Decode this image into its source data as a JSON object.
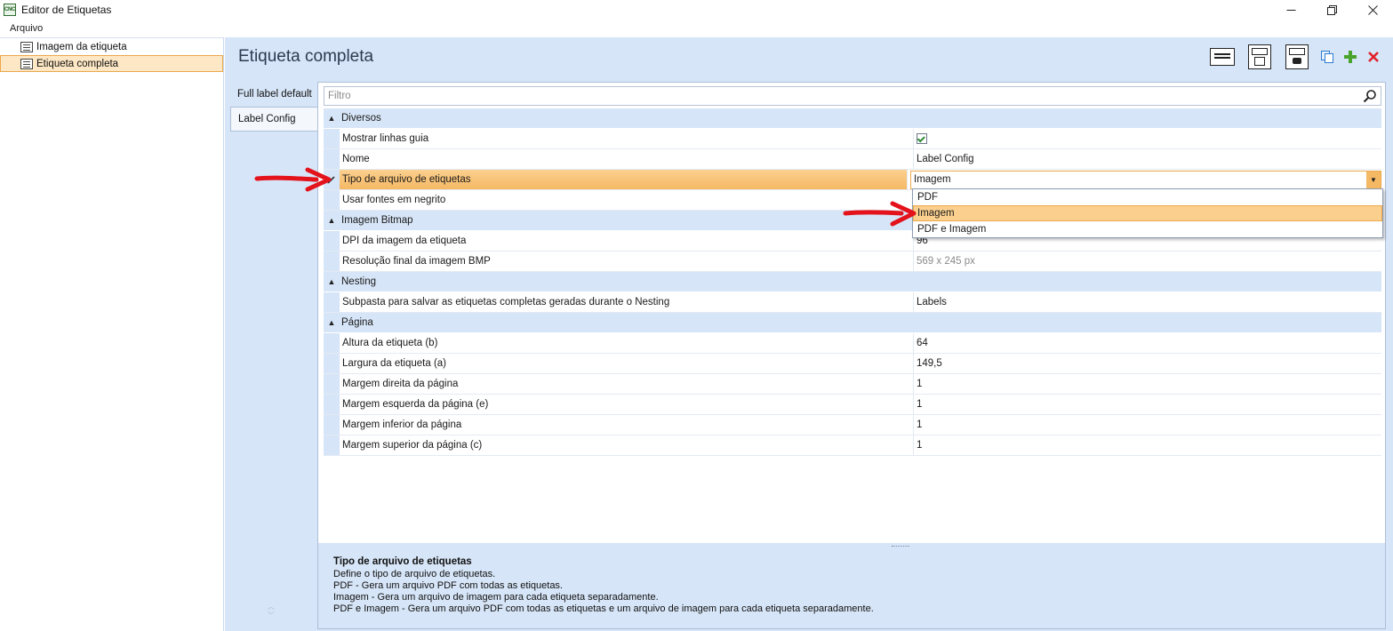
{
  "window": {
    "title": "Editor de Etiquetas",
    "icon_text": "CNC",
    "controls": [
      "minimize-icon",
      "maximize-icon",
      "close-icon"
    ]
  },
  "menu": {
    "items": [
      "Arquivo"
    ]
  },
  "tree": {
    "items": [
      {
        "label": "Imagem da etiqueta",
        "selected": false
      },
      {
        "label": "Etiqueta completa",
        "selected": true
      }
    ]
  },
  "header": {
    "title": "Etiqueta completa",
    "toolbar_icons": [
      "label-preview-icon",
      "label-layout-icon",
      "label-image-icon",
      "copy-icon",
      "add-icon",
      "delete-icon"
    ]
  },
  "tabs": {
    "items": [
      {
        "label": "Full label default",
        "active": false
      },
      {
        "label": "Label Config",
        "active": true
      }
    ]
  },
  "filter": {
    "placeholder": "Filtro",
    "value": ""
  },
  "grid": {
    "categories": [
      {
        "label": "Diversos",
        "rows": [
          {
            "name": "Mostrar linhas guia",
            "value": "",
            "type": "checkbox",
            "checked": true
          },
          {
            "name": "Nome",
            "value": "Label Config"
          },
          {
            "name": "Tipo de arquivo de etiquetas",
            "value": "Imagem",
            "type": "combo",
            "selected": true
          },
          {
            "name": "Usar fontes em negrito",
            "value": ""
          }
        ]
      },
      {
        "label": "Imagem Bitmap",
        "rows": [
          {
            "name": "DPI da imagem da etiqueta",
            "value": "96"
          },
          {
            "name": "Resolução final da imagem BMP",
            "value": "569 x 245 px",
            "readonly": true
          }
        ]
      },
      {
        "label": "Nesting",
        "rows": [
          {
            "name": "Subpasta para salvar as etiquetas completas geradas durante o Nesting",
            "value": "Labels"
          }
        ]
      },
      {
        "label": "Página",
        "rows": [
          {
            "name": "Altura da etiqueta (b)",
            "value": "64"
          },
          {
            "name": "Largura da etiqueta (a)",
            "value": "149,5"
          },
          {
            "name": "Margem direita da página",
            "value": "1"
          },
          {
            "name": "Margem esquerda da página (e)",
            "value": "1"
          },
          {
            "name": "Margem inferior da página",
            "value": "1"
          },
          {
            "name": "Margem superior da página (c)",
            "value": "1"
          }
        ]
      }
    ]
  },
  "dropdown": {
    "options": [
      "PDF",
      "Imagem",
      "PDF e Imagem"
    ],
    "highlighted": "Imagem"
  },
  "description": {
    "title": "Tipo de arquivo de etiquetas",
    "lines": [
      "Define o tipo de arquivo de etiquetas.",
      "PDF - Gera um arquivo PDF com todas as etiquetas.",
      "Imagem - Gera um arquivo de imagem para cada etiqueta separadamente.",
      "PDF e Imagem - Gera um arquivo PDF com todas as etiquetas e um arquivo de imagem para cada etiqueta separadamente."
    ]
  },
  "colors": {
    "accent_orange": "#f5b864",
    "panel_blue": "#d6e5f7",
    "arrow_red": "#e3121b"
  }
}
